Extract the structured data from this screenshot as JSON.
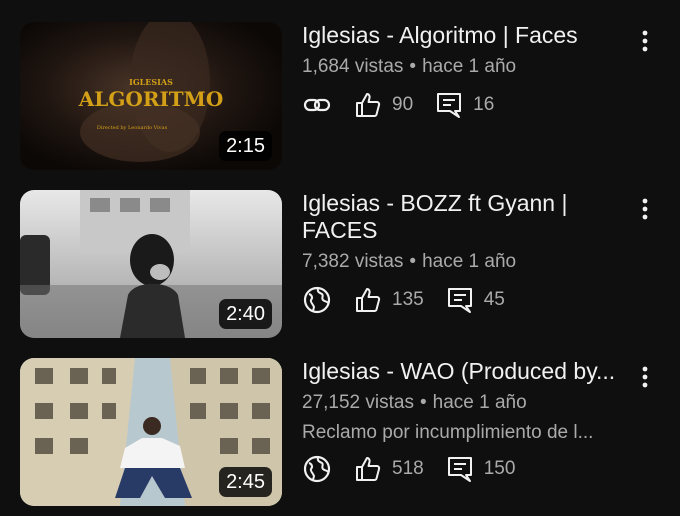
{
  "videos": [
    {
      "title": "Iglesias - Algoritmo | Faces",
      "views": "1,684 vistas",
      "age": "hace 1 año",
      "duration": "2:15",
      "visibility_icon": "link-icon",
      "likes": "90",
      "comments": "16",
      "thumb_text": {
        "top": "IGLESIAS",
        "main": "ALGORITMO",
        "credit": "Directed by Leonardo Vivas"
      }
    },
    {
      "title": "Iglesias - BOZZ ft Gyann | FACES",
      "views": "7,382 vistas",
      "age": "hace 1 año",
      "duration": "2:40",
      "visibility_icon": "globe-icon",
      "likes": "135",
      "comments": "45"
    },
    {
      "title": "Iglesias - WAO (Produced by...",
      "views": "27,152 vistas",
      "age": "hace 1 año",
      "claim": "Reclamo por incumplimiento de l...",
      "duration": "2:45",
      "visibility_icon": "globe-icon",
      "likes": "518",
      "comments": "150"
    }
  ],
  "meta_separator": "•",
  "colors": {
    "background": "#0f0f0f",
    "text_primary": "#f1f1f1",
    "text_secondary": "#aaaaaa",
    "thumb_gold": "#d4a018"
  }
}
